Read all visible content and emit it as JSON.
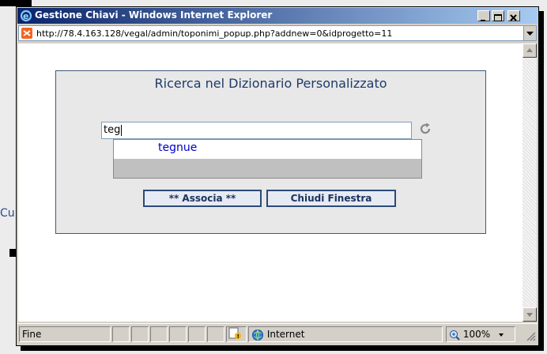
{
  "window": {
    "title": "Gestione Chiavi - Windows Internet Explorer",
    "url": "http://78.4.163.128/vegal/admin/toponimi_popup.php?addnew=0&idprogetto=11"
  },
  "background": {
    "partial_text": "Cu"
  },
  "panel": {
    "title": "Ricerca nel Dizionario Personalizzato",
    "search_value": "teg",
    "suggestions": [
      "tegnue"
    ],
    "associa_label": "** Associa **",
    "chiudi_label": "Chiudi Finestra"
  },
  "status": {
    "text": "Fine",
    "zone": "Internet",
    "zoom": "100%"
  },
  "colors": {
    "titlebar_start": "#0a246a",
    "panel_title": "#1f3a68",
    "suggestion_link": "#0000cc"
  }
}
